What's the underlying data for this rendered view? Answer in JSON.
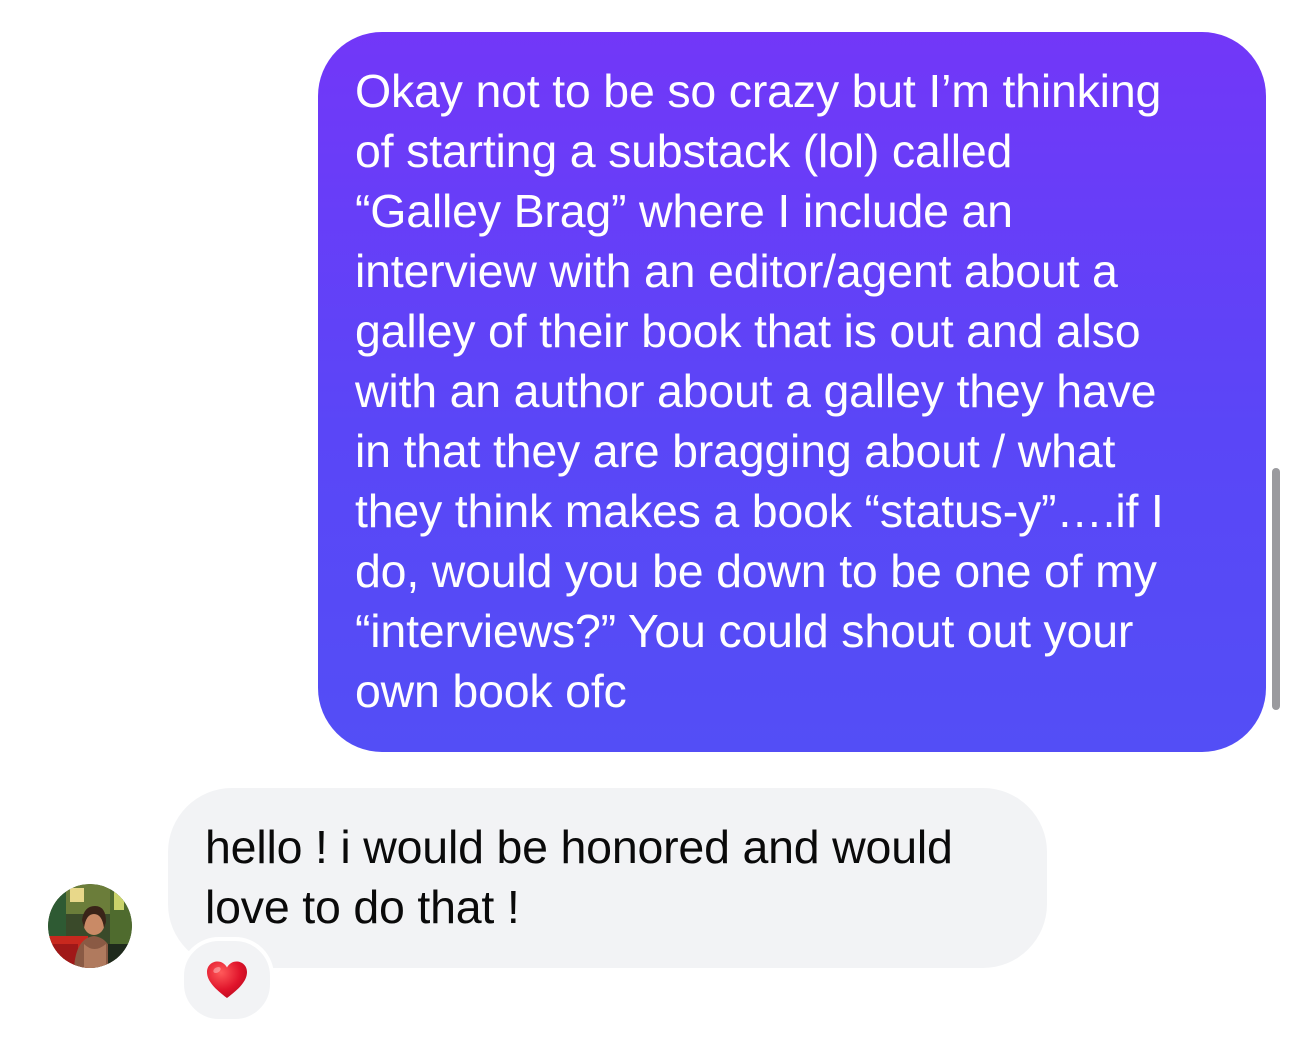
{
  "messages": [
    {
      "direction": "sent",
      "lines": [
        "Okay not to be so crazy but I’m thinking",
        "of starting a substack (lol) called",
        "“Galley Brag” where I include an",
        "interview with an editor/agent about a",
        "galley of their book that is out and also",
        "with an author about a galley they have",
        "in that they are bragging about / what",
        "they think makes a book “status-y”….if I",
        "do, would you be down to be one of my",
        "“interviews?” You could shout out your",
        "own book ofc"
      ]
    },
    {
      "direction": "received",
      "lines": [
        "hello ! i would be honored and would",
        "love to do that !"
      ],
      "reaction": "heart-reaction"
    }
  ],
  "colors": {
    "sent_bubble_top": "#7237f8",
    "sent_bubble_bottom": "#534ef6",
    "received_bubble": "#f2f3f5",
    "reaction_heart": "#e0142b"
  },
  "icons": {
    "avatar": "user-avatar-photo",
    "reaction": "red-heart-icon"
  }
}
